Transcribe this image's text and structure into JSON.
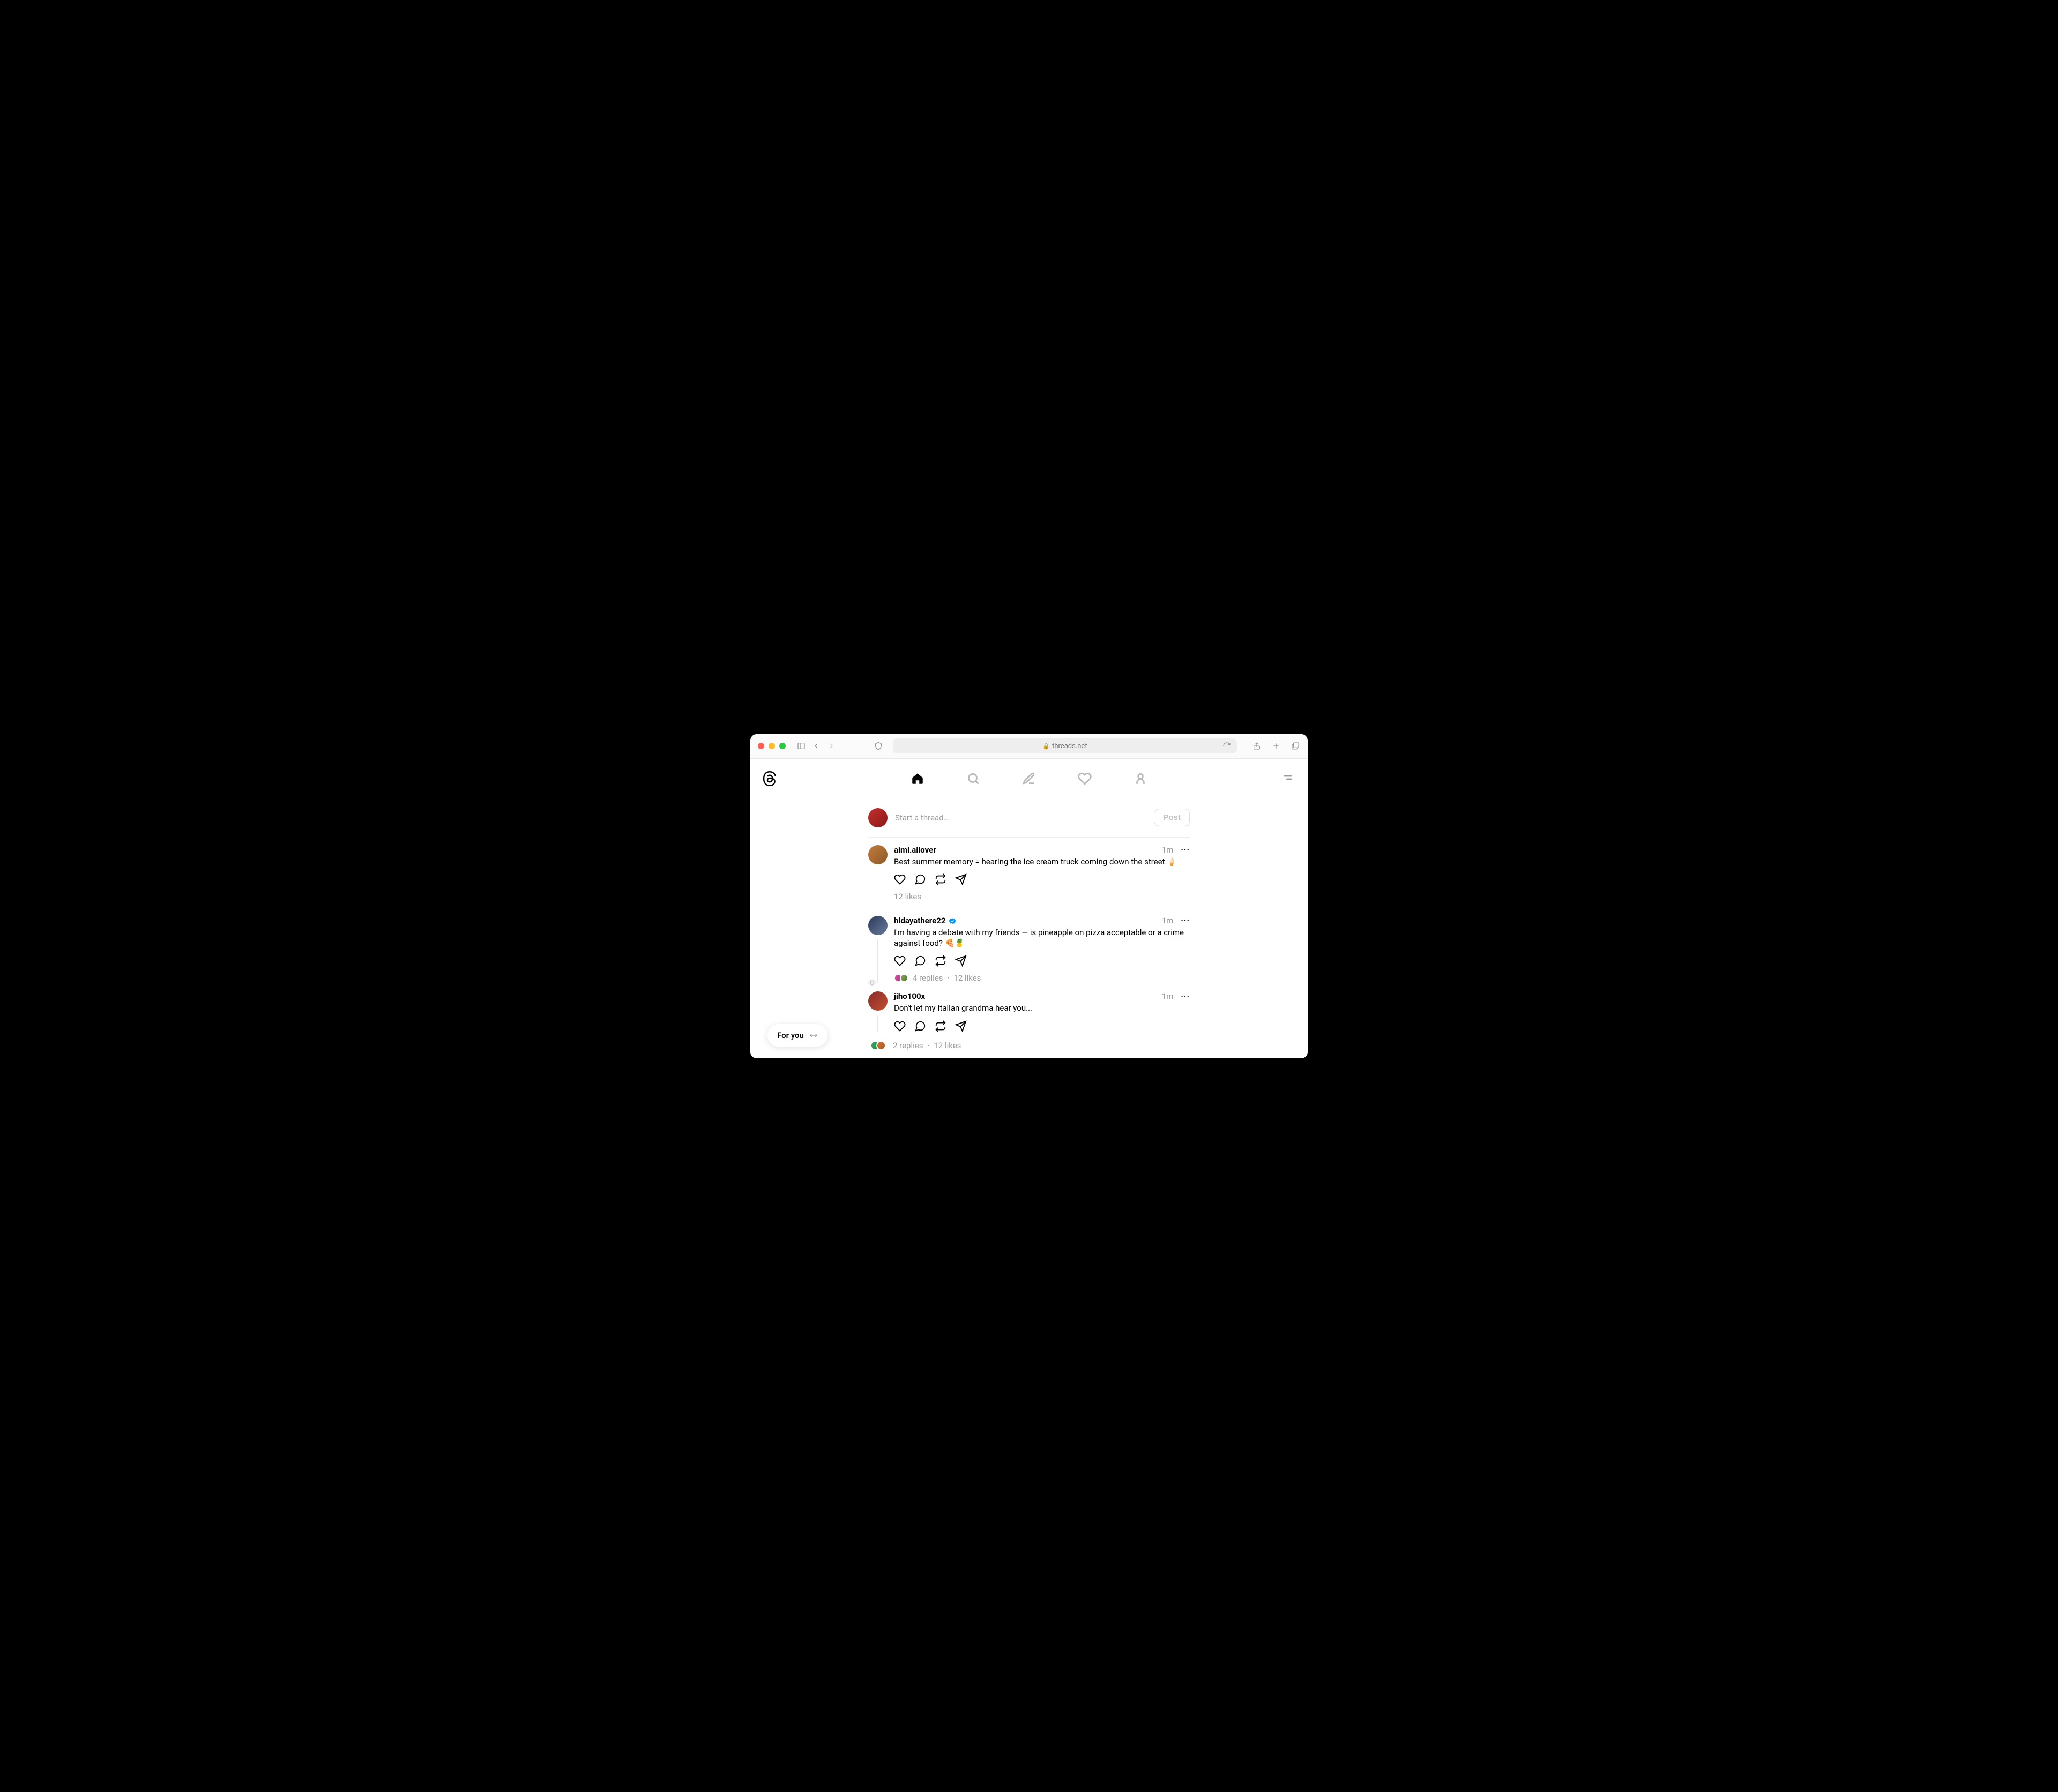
{
  "browser": {
    "url_display": "threads.net"
  },
  "composer": {
    "placeholder": "Start a thread...",
    "post_button": "Post"
  },
  "pill": {
    "label": "For you"
  },
  "posts": [
    {
      "username": "aimi.allover",
      "verified": false,
      "time": "1m",
      "body": "Best summer memory = hearing the ice cream truck coming down the street 🍦",
      "likes_text": "12 likes",
      "replies_text": "",
      "has_thread": false,
      "avatar_bg": "linear-gradient(135deg,#c47b3a,#8a5a2a)"
    },
    {
      "username": "hidayathere22",
      "verified": true,
      "time": "1m",
      "body": "I'm having a debate with my friends — is pineapple on pizza acceptable or a crime against food? 🍕🍍",
      "likes_text": "12 likes",
      "replies_text": "4 replies",
      "has_thread": true,
      "avatar_bg": "linear-gradient(135deg,#2a3a5a,#6a7a9a)",
      "reply": {
        "username": "jiho100x",
        "time": "1m",
        "body": "Don't let my Italian grandma hear you...",
        "avatar_bg": "linear-gradient(135deg,#8a2a2a,#c05030)"
      },
      "cluster": {
        "replies_text": "2 replies",
        "likes_text": "12 likes"
      }
    }
  ]
}
